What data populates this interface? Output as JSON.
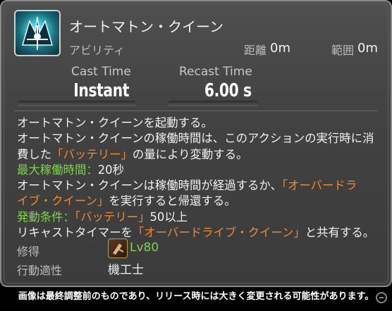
{
  "action": {
    "name": "オートマトン・クイーン",
    "category": "アビリティ",
    "range_label": "距離",
    "range_value": "0m",
    "radius_label": "範囲",
    "radius_value": "0m",
    "cast_label": "Cast Time",
    "cast_value": "Instant",
    "recast_label": "Recast Time",
    "recast_value": "6.00 s"
  },
  "description": {
    "l1": "オートマトン・クイーンを起動する。",
    "l2": "オートマトン・クイーンの稼働時間は、このアクションの実行時に消",
    "l3_a": "費した",
    "l3_b": "「バッテリー」",
    "l3_c": "の量により変動する。",
    "l4_label": "最大稼働時間：",
    "l4_value": "20秒",
    "l5_a": "オートマトン・クイーンは稼働時間が経過するか、",
    "l5_b": "「オーバードラ",
    "l6_a": "イブ・クイーン」",
    "l6_b": "を実行すると帰還する。",
    "l7_label": "発動条件：",
    "l7_b": "「バッテリー」",
    "l7_c": "50以上",
    "l8_a": "リキャストタイマーを",
    "l8_b": "「オーバードライブ・クイーン」",
    "l8_c": "と共有する。"
  },
  "footer": {
    "acquired_label": "修得",
    "level": "Lv80",
    "class_label": "行動適性",
    "class_value": "機工士"
  },
  "caption": "画像は最終調整前のものであり、リリース時には大きく変更される可能性があります。",
  "colors": {
    "green": "#7ed24f",
    "orange": "#f08a32"
  }
}
